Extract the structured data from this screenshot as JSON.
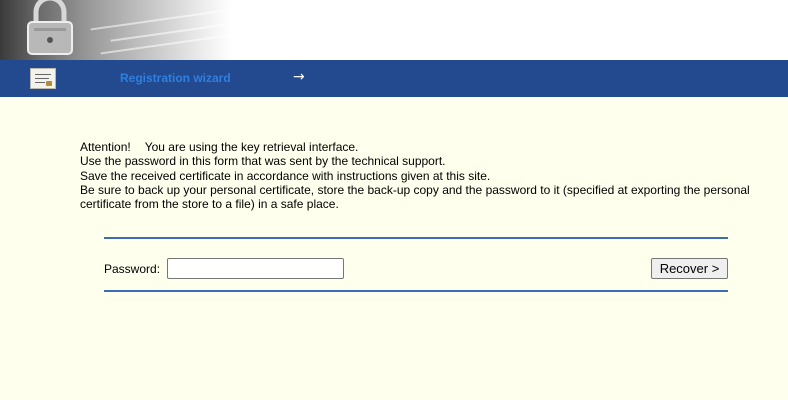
{
  "header": {
    "banner_icon": "padlock-image"
  },
  "nav": {
    "icon": "certificate-icon",
    "link_label": "Registration wizard",
    "arrow_icon": "→"
  },
  "notice": {
    "attention": "Attention!",
    "line1_rest": "You are using the key retrieval interface.",
    "line2": "Use the password in this form that was sent by the technical support.",
    "line3": "Save the received certificate in accordance with instructions given at this site.",
    "line4": "Be sure to back up your personal certificate, store the back-up copy and the password to it (specified at exporting the personal certificate from the store to a file) in a safe place."
  },
  "form": {
    "password_label": "Password:",
    "password_value": "",
    "recover_label": "Recover >"
  },
  "colors": {
    "nav_bar": "#234a8f",
    "link": "#2f7fe0",
    "content_bg": "#ffffee",
    "rule": "#3d6db6"
  }
}
